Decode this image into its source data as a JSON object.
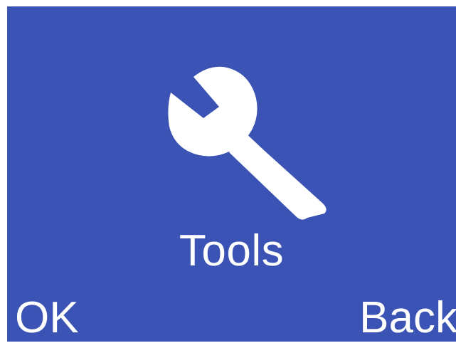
{
  "screen": {
    "background_color": "#3a53b4",
    "foreground_color": "#ffffff"
  },
  "menu": {
    "icon": "wrench-icon",
    "title": "Tools"
  },
  "softkeys": {
    "left_label": "OK",
    "right_label": "Back"
  }
}
